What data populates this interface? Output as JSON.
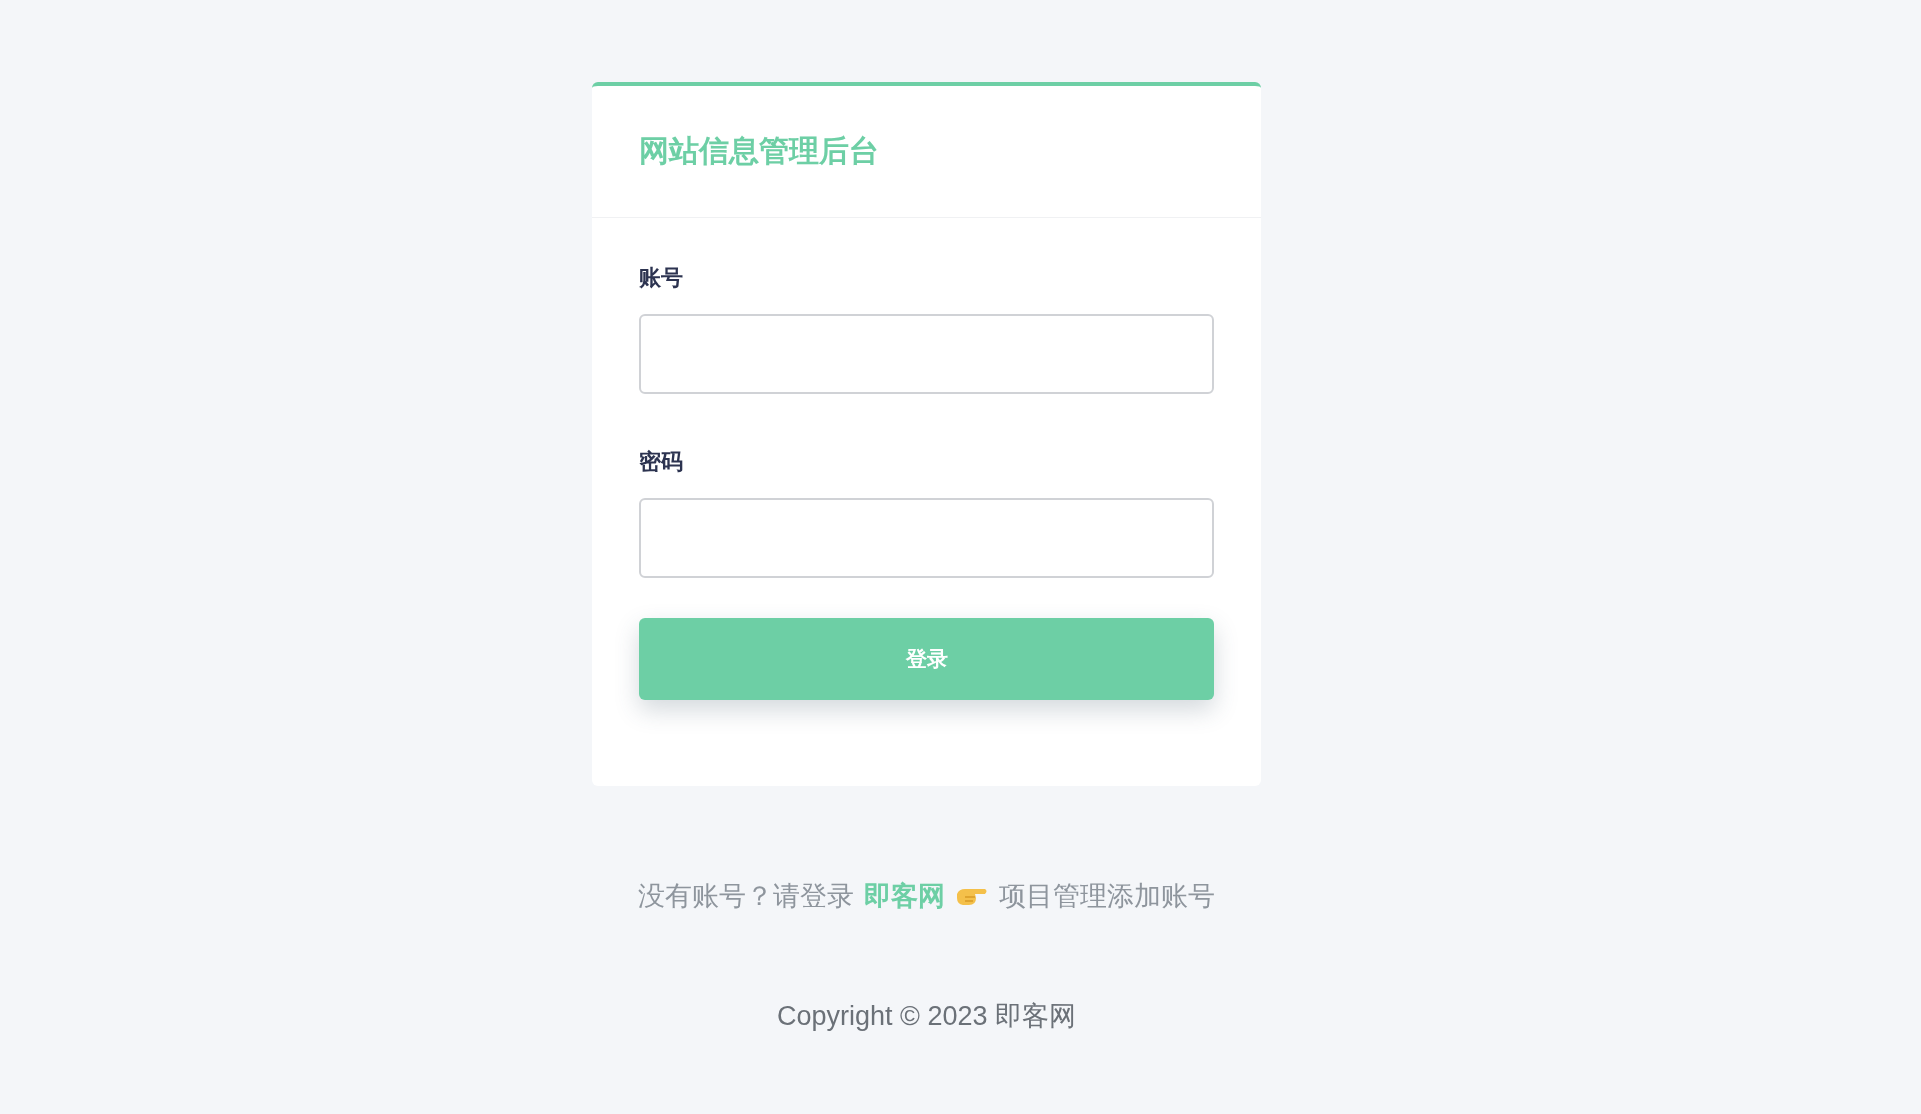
{
  "card": {
    "title": "网站信息管理后台"
  },
  "fields": [
    {
      "label": "账号"
    },
    {
      "label": "密码"
    }
  ],
  "login_button": {
    "label": "登录"
  },
  "hint": {
    "prefix": "没有账号？请登录",
    "link": "即客网",
    "suffix": "项目管理添加账号"
  },
  "copyright": "Copyright © 2023 即客网"
}
